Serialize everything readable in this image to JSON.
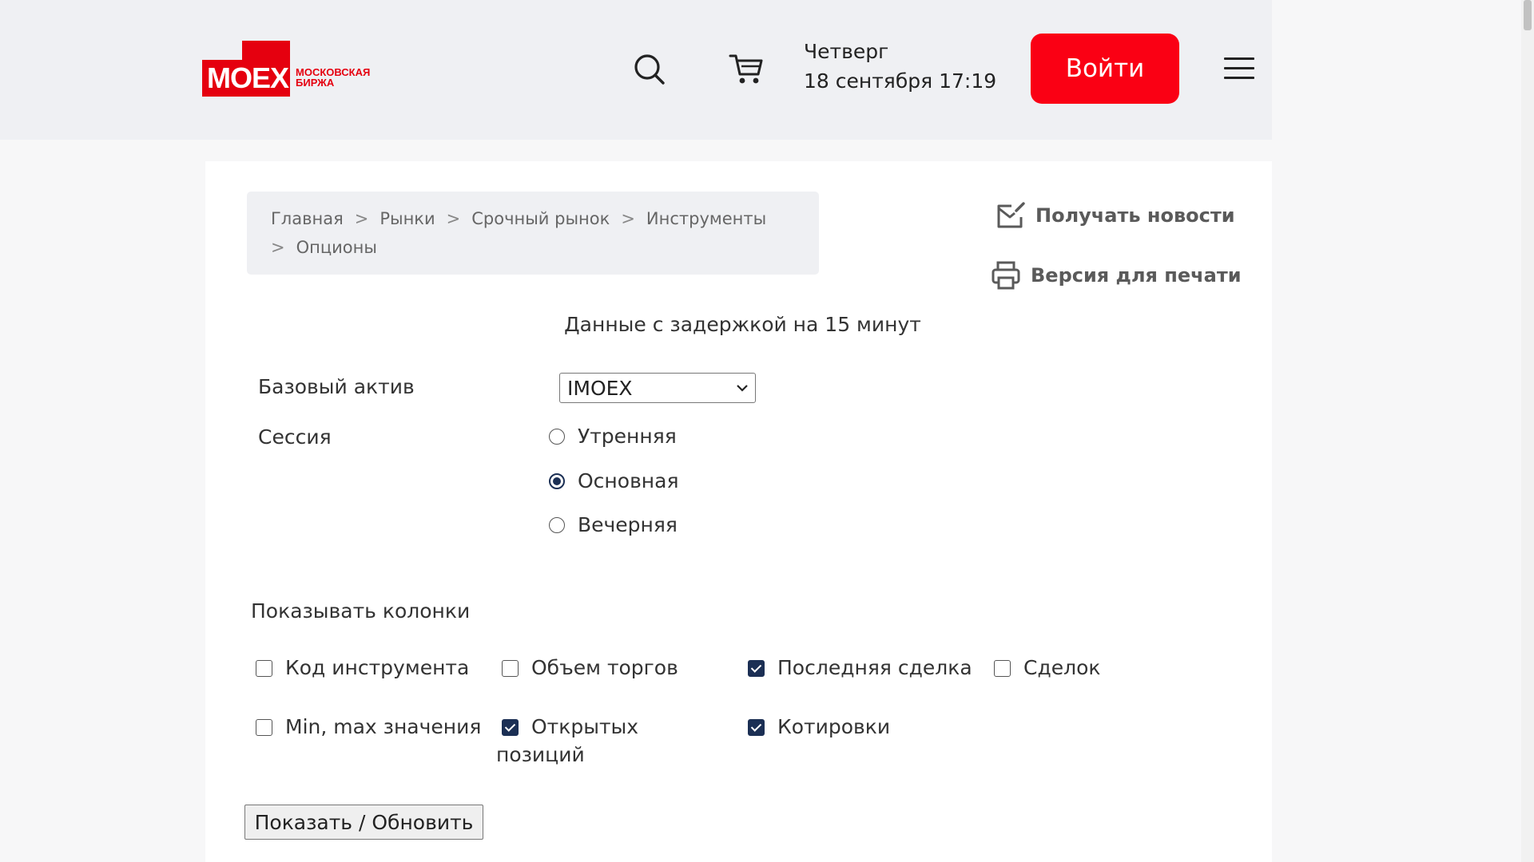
{
  "header": {
    "logo_text": "MOEX",
    "logo_name_line1": "Московская",
    "logo_name_line2": "Биржа",
    "day_of_week": "Четверг",
    "date_time": "18 сентября 17:19",
    "login_label": "Войти",
    "icons": [
      "search-icon",
      "cart-icon",
      "menu-icon"
    ]
  },
  "breadcrumb": {
    "items": [
      "Главная",
      "Рынки",
      "Срочный рынок",
      "Инструменты",
      "Опционы"
    ],
    "separator": ">"
  },
  "side_links": {
    "subscribe": "Получать новости",
    "print": "Версия для печати"
  },
  "delay_note": "Данные с задержкой на 15 минут",
  "form": {
    "base_asset_label": "Базовый актив",
    "base_asset_value": "IMOEX",
    "session_label": "Сессия",
    "sessions": [
      {
        "label": "Утренняя",
        "selected": false
      },
      {
        "label": "Основная",
        "selected": true
      },
      {
        "label": "Вечерняя",
        "selected": false
      }
    ],
    "columns_label": "Показывать колонки",
    "columns": [
      {
        "label": "Код инструмента",
        "checked": false
      },
      {
        "label": "Объем торгов",
        "checked": false
      },
      {
        "label": "Последняя сделка",
        "checked": true
      },
      {
        "label": "Сделок",
        "checked": false
      },
      {
        "label": "Min, max значения",
        "checked": false
      },
      {
        "label_line1": "Открытых",
        "label_line2": "позиций",
        "checked": true
      },
      {
        "label": "Котировки",
        "checked": true
      }
    ],
    "submit_label": "Показать / Обновить"
  },
  "colors": {
    "brand_red": "#e5000f",
    "button_red": "#fa0014",
    "checked_navy": "#1b2f54",
    "header_bg": "#eff0f3"
  }
}
